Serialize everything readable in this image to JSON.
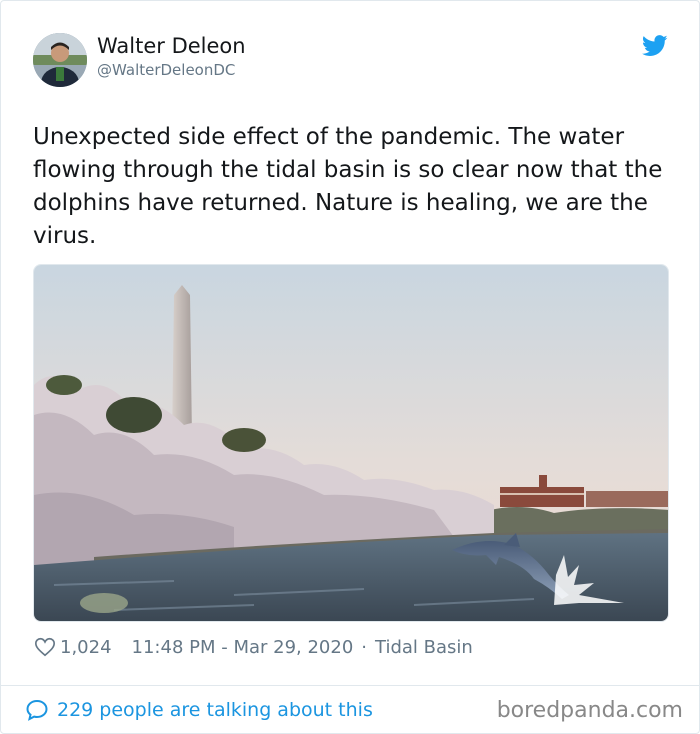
{
  "author": {
    "name": "Walter Deleon",
    "handle": "@WalterDeleonDC"
  },
  "tweet": {
    "text": "Unexpected side effect of the pandemic. The water flowing through the tidal basin is so clear now that the dolphins have returned. Nature is healing, we are the virus."
  },
  "meta": {
    "likes": "1,024",
    "timestamp": "11:48 PM - Mar 29, 2020",
    "separator": "·",
    "location": "Tidal Basin"
  },
  "footer": {
    "talking": "229 people are talking about this",
    "watermark": "boredpanda.com"
  },
  "colors": {
    "twitter_blue": "#1da1f2",
    "link_blue": "#1b95e0",
    "muted_gray": "#657786"
  },
  "icons": [
    "avatar",
    "twitter-bird-icon",
    "heart-icon",
    "speech-bubble-icon"
  ]
}
